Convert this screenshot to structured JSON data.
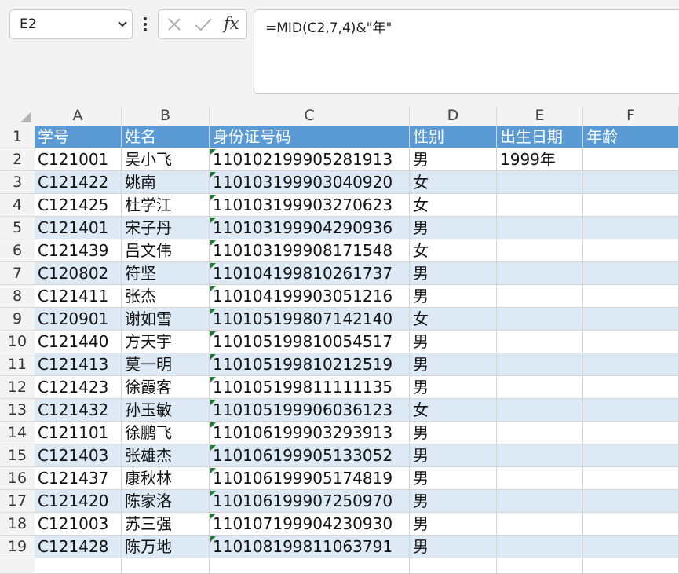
{
  "name_box": {
    "value": "E2"
  },
  "formula_bar": {
    "fx_label": "fx",
    "formula": "=MID(C2,7,4)&\"年\""
  },
  "columns": [
    "A",
    "B",
    "C",
    "D",
    "E",
    "F"
  ],
  "headers": [
    "学号",
    "姓名",
    "身份证号码",
    "性别",
    "出生日期",
    "年龄"
  ],
  "rows": [
    [
      "C121001",
      "吴小飞",
      "110102199905281913",
      "男",
      "1999年",
      ""
    ],
    [
      "C121422",
      "姚南",
      "110103199903040920",
      "女",
      "",
      ""
    ],
    [
      "C121425",
      "杜学江",
      "110103199903270623",
      "女",
      "",
      ""
    ],
    [
      "C121401",
      "宋子丹",
      "110103199904290936",
      "男",
      "",
      ""
    ],
    [
      "C121439",
      "吕文伟",
      "110103199908171548",
      "女",
      "",
      ""
    ],
    [
      "C120802",
      "符坚",
      "110104199810261737",
      "男",
      "",
      ""
    ],
    [
      "C121411",
      "张杰",
      "110104199903051216",
      "男",
      "",
      ""
    ],
    [
      "C120901",
      "谢如雪",
      "110105199807142140",
      "女",
      "",
      ""
    ],
    [
      "C121440",
      "方天宇",
      "110105199810054517",
      "男",
      "",
      ""
    ],
    [
      "C121413",
      "莫一明",
      "110105199810212519",
      "男",
      "",
      ""
    ],
    [
      "C121423",
      "徐霞客",
      "110105199811111135",
      "男",
      "",
      ""
    ],
    [
      "C121432",
      "孙玉敏",
      "110105199906036123",
      "女",
      "",
      ""
    ],
    [
      "C121101",
      "徐鹏飞",
      "110106199903293913",
      "男",
      "",
      ""
    ],
    [
      "C121403",
      "张雄杰",
      "110106199905133052",
      "男",
      "",
      ""
    ],
    [
      "C121437",
      "康秋林",
      "110106199905174819",
      "男",
      "",
      ""
    ],
    [
      "C121420",
      "陈家洛",
      "110106199907250970",
      "男",
      "",
      ""
    ],
    [
      "C121003",
      "苏三强",
      "110107199904230930",
      "男",
      "",
      ""
    ],
    [
      "C121428",
      "陈万地",
      "110108199811063791",
      "男",
      "",
      ""
    ]
  ],
  "colors": {
    "header_fill": "#5b9bd5",
    "band_fill": "#dde9f5",
    "text_flag": "#1e7b34"
  }
}
